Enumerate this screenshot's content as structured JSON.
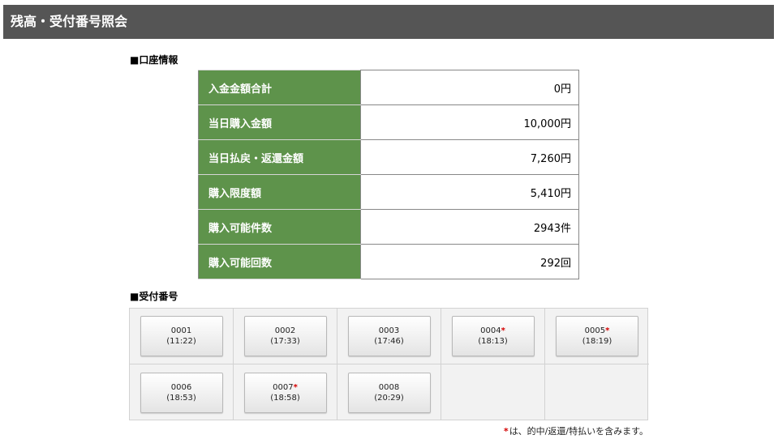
{
  "page": {
    "title": "残高・受付番号照会"
  },
  "account_section": {
    "heading": "■口座情報",
    "rows": [
      {
        "label": "入金金額合計",
        "value": "0円"
      },
      {
        "label": "当日購入金額",
        "value": "10,000円"
      },
      {
        "label": "当日払戻・返還金額",
        "value": "7,260円"
      },
      {
        "label": "購入限度額",
        "value": "5,410円"
      },
      {
        "label": "購入可能件数",
        "value": "2943件"
      },
      {
        "label": "購入可能回数",
        "value": "292回"
      }
    ]
  },
  "receipt_section": {
    "heading": "■受付番号",
    "buttons": [
      {
        "number": "0001",
        "time": "(11:22)",
        "star": ""
      },
      {
        "number": "0002",
        "time": "(17:33)",
        "star": ""
      },
      {
        "number": "0003",
        "time": "(17:46)",
        "star": ""
      },
      {
        "number": "0004",
        "time": "(18:13)",
        "star": "*"
      },
      {
        "number": "0005",
        "time": "(18:19)",
        "star": "*"
      },
      {
        "number": "0006",
        "time": "(18:53)",
        "star": ""
      },
      {
        "number": "0007",
        "time": "(18:58)",
        "star": "*"
      },
      {
        "number": "0008",
        "time": "(20:29)",
        "star": ""
      }
    ],
    "footnote_star": "*",
    "footnote_text": "は、的中/返還/特払いを含みます。"
  },
  "colors": {
    "title_bar": "#555555",
    "label_bg": "#5e934b",
    "star": "#d40000"
  }
}
